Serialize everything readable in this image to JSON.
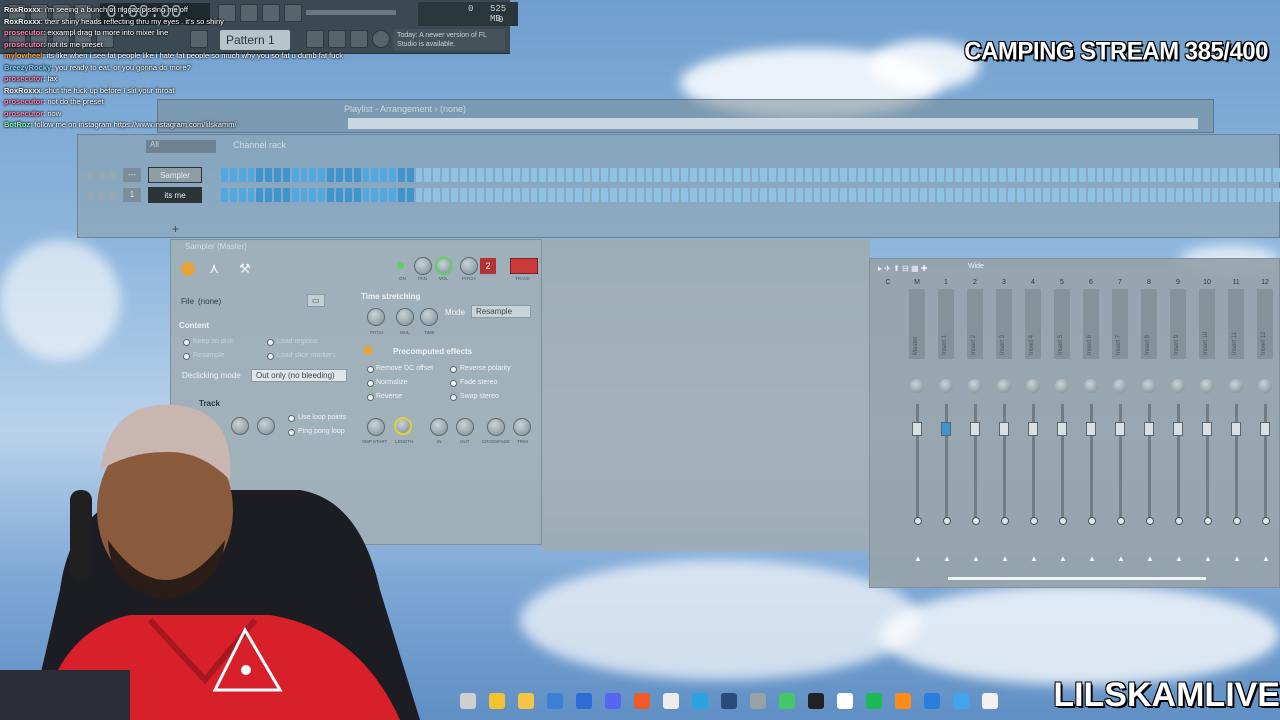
{
  "overlay": {
    "stream_title": "CAMPING STREAM 385/400",
    "channel_name": "LILSKAMLIVE"
  },
  "chat": [
    {
      "user": "RoxRoxxx",
      "text": ": i'm seeing a bunch of niggaz pissing me off",
      "color": "#ffffff"
    },
    {
      "user": "RoxRoxxx",
      "text": ": their shiny heads reflecting thru my eyes . it's so shiny",
      "color": "#ffffff"
    },
    {
      "user": "prosecutor",
      "text": ": exxampl drag to more into mixer line",
      "color": "#ff7fb0"
    },
    {
      "user": "prosecutor",
      "text": ": not its me preset",
      "color": "#ff7fb0"
    },
    {
      "user": "mylowheel",
      "text": ": its like when i see fat people like i hate fat people so much why you so fat u dumb fat fuck",
      "color": "#ff9a3c"
    },
    {
      "user": "BreezyRocky",
      "text": ": you ready to eat, or you gonna do more?",
      "color": "#7fd0ff"
    },
    {
      "user": "prosecutor",
      "text": ": fax",
      "color": "#ff7fb0"
    },
    {
      "user": "RoxRoxxx",
      "text": ": shut the fuck up before I slit your throat",
      "color": "#ffffff"
    },
    {
      "user": "prosecutor",
      "text": ": not do the preset",
      "color": "#ff7fb0"
    },
    {
      "user": "prosecutor",
      "text": ": now",
      "color": "#ff7fb0"
    },
    {
      "user": "BotRoz",
      "text": ": follow me on instagram https://www.instagram.com/lilskamm/",
      "color": "#7fffb0"
    }
  ],
  "toolbar": {
    "time": "0:00:00",
    "pattern": "Pattern 1",
    "cpu_value": "0",
    "memory": "525 MB",
    "voices": "0",
    "news": "Today: A newer version of FL Studio is available."
  },
  "playlist": {
    "title": "Playlist - Arrangement › (none)"
  },
  "channel_rack": {
    "title": "Channel rack",
    "filter": "All",
    "channels": [
      {
        "name": "Sampler",
        "mixer_track": "---"
      },
      {
        "name": "its me",
        "mixer_track": "1"
      }
    ]
  },
  "sampler": {
    "title": "Sampler (Master)",
    "file_label": "File",
    "file_value": "(none)",
    "content_label": "Content",
    "content_options": [
      "Keep on disk",
      "Resample",
      "Load regions",
      "Load slice markers"
    ],
    "declicking_label": "Declicking mode",
    "declicking_value": "Out only (no bleeding)",
    "loop_label": "Track",
    "loop_options": [
      "Use loop points",
      "Ping pong loop"
    ],
    "time_stretching_label": "Time stretching",
    "mode_label": "Mode",
    "mode_value": "Resample",
    "ts_knobs": [
      "PITCH",
      "MUL",
      "TIME"
    ],
    "precomputed_label": "Precomputed effects",
    "effects": [
      "Remove DC offset",
      "Normalize",
      "Reverse",
      "Reverse polarity",
      "Fade stereo",
      "Swap stereo"
    ],
    "effect_knobs": [
      "SMP START",
      "LENGTH",
      "IN",
      "OUT",
      "CROSSFADE",
      "TRIM"
    ],
    "top_knobs": [
      "ON",
      "PAN",
      "VOL",
      "PITCH",
      "TRACK"
    ],
    "pitch_range": "2"
  },
  "mixer": {
    "preset": "Wide",
    "tracks": [
      "C",
      "M",
      "1",
      "2",
      "3",
      "4",
      "5",
      "6",
      "7",
      "8",
      "9",
      "10",
      "11",
      "12"
    ],
    "insert_labels": [
      "Master",
      "Insert 1",
      "Insert 2",
      "Insert 3",
      "Insert 4",
      "Insert 5",
      "Insert 6",
      "Insert 7",
      "Insert 8",
      "Insert 9",
      "Insert 10",
      "Insert 11",
      "Insert 12"
    ],
    "scale": [
      "3",
      "6",
      "9",
      "12",
      "15",
      "18",
      "21",
      "24",
      "27",
      "33",
      "36"
    ]
  },
  "taskbar": {
    "icons": [
      "taskview-icon",
      "chrome-icon",
      "folder-icon",
      "store-icon",
      "photoshop-icon",
      "discord-icon",
      "brave-icon",
      "obs-icon",
      "telegram-icon",
      "steam-icon",
      "keyboard-icon",
      "razer-icon",
      "4k-icon",
      "capcut-icon",
      "spotify-icon",
      "fl-studio-icon",
      "notepad-icon",
      "photos-icon",
      "file-icon"
    ]
  }
}
